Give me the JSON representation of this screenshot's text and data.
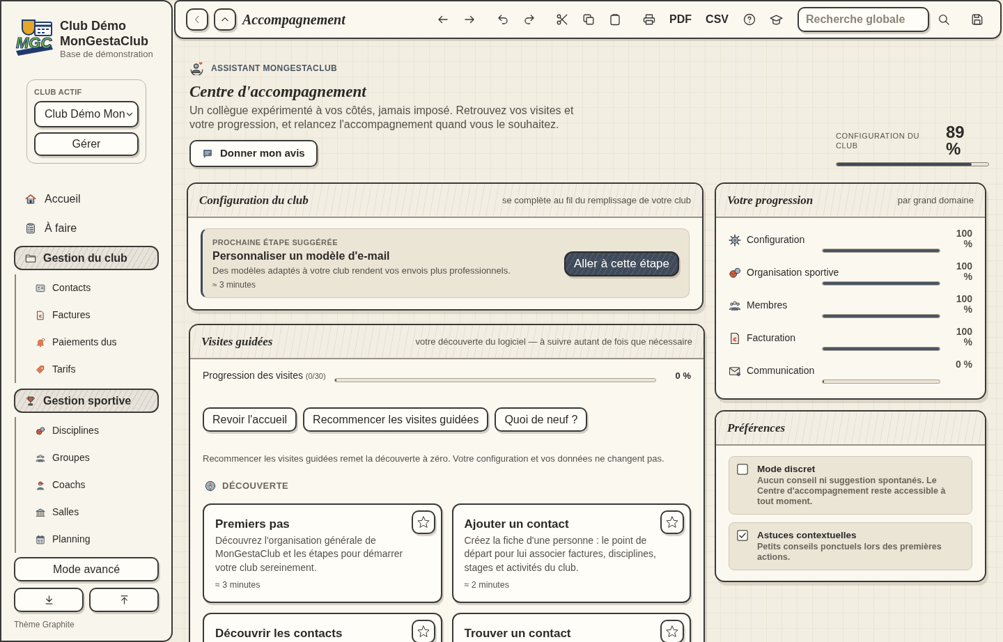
{
  "sidebar": {
    "logo_text": "MGC",
    "club_name": "Club Démo MonGestaClub",
    "subtitle": "Base de démonstration",
    "active_club": {
      "label": "CLUB ACTIF",
      "value": "Club Démo Mon",
      "manage_button": "Gérer"
    },
    "nav": [
      {
        "kind": "link",
        "label": "Accueil"
      },
      {
        "kind": "link",
        "label": "À faire"
      },
      {
        "kind": "group",
        "label": "Gestion du club",
        "expanded": true,
        "children": [
          {
            "label": "Contacts"
          },
          {
            "label": "Factures"
          },
          {
            "label": "Paiements dus"
          },
          {
            "label": "Tarifs"
          }
        ]
      },
      {
        "kind": "group",
        "label": "Gestion sportive",
        "expanded": true,
        "children": [
          {
            "label": "Disciplines"
          },
          {
            "label": "Groupes"
          },
          {
            "label": "Coachs"
          },
          {
            "label": "Salles"
          },
          {
            "label": "Planning"
          }
        ]
      }
    ],
    "advanced_button": "Mode avancé",
    "theme_label": "Thème Graphite"
  },
  "toolbar": {
    "title": "Accompagnement",
    "export_buttons": [
      "PDF",
      "CSV"
    ],
    "search": {
      "placeholder": "Recherche globale"
    }
  },
  "assistant": {
    "eyebrow": "ASSISTANT MONGESTACLUB",
    "title": "Centre d'accompagnement",
    "description": "Un collègue expérimenté à vos côtés, jamais imposé. Retrouvez vos visites et votre progression, et relancez l'accompagnement quand vous le souhaitez.",
    "feedback_button": "Donner mon avis",
    "club_config": {
      "label": "CONFIGURATION DU CLUB",
      "reading": "89 %",
      "level": 0.89
    }
  },
  "configuration_card": {
    "title": "Configuration du club",
    "subtitle": "se complète au fil du remplissage de votre club",
    "next_step": {
      "eyebrow": "PROCHAINE ÉTAPE SUGGÉRÉE",
      "title": "Personnaliser un modèle d'e-mail",
      "description": "Des modèles adaptés à votre club rendent vos envois plus professionnels.",
      "duration": "≈ 3 minutes",
      "button": "Aller à cette étape"
    }
  },
  "guided_tours": {
    "title": "Visites guidées",
    "subtitle": "votre découverte du logiciel — à suivre autant de fois que nécessaire",
    "progress": {
      "label": "Progression des visites",
      "count": "(0/30)",
      "level": 0,
      "reading": "0 %"
    },
    "buttons": [
      "Revoir l'accueil",
      "Recommencer les visites guidées",
      "Quoi de neuf ?"
    ],
    "note": "Recommencer les visites guidées remet la découverte à zéro. Votre configuration et vos données ne changent pas.",
    "section": "DÉCOUVERTE",
    "tours": [
      {
        "title": "Premiers pas",
        "description": "Découvrez l'organisation générale de MonGestaClub et les étapes pour démarrer votre club sereinement.",
        "duration": "≈ 3 minutes",
        "favorite": false
      },
      {
        "title": "Ajouter un contact",
        "description": "Créez la fiche d'une personne : le point de départ pour lui associer factures, disciplines, stages et activités du club.",
        "duration": "≈ 2 minutes",
        "favorite": false
      },
      {
        "title": "Découvrir les contacts",
        "favorite": false
      },
      {
        "title": "Trouver un contact",
        "favorite": false
      }
    ]
  },
  "progression": {
    "title": "Votre progression",
    "subtitle": "par grand domaine",
    "domains": [
      {
        "name": "Configuration",
        "level": 1,
        "reading": "100 %"
      },
      {
        "name": "Organisation sportive",
        "level": 1,
        "reading": "100 %"
      },
      {
        "name": "Membres",
        "level": 1,
        "reading": "100 %"
      },
      {
        "name": "Facturation",
        "level": 1,
        "reading": "100 %"
      },
      {
        "name": "Communication",
        "level": 0,
        "reading": "0 %"
      }
    ]
  },
  "preferences": {
    "title": "Préférences",
    "options": [
      {
        "title": "Mode discret",
        "description": "Aucun conseil ni suggestion spontanés. Le Centre d'accompagnement reste accessible à tout moment.",
        "checked": false
      },
      {
        "title": "Astuces contextuelles",
        "description": "Petits conseils ponctuels lors des premières actions.",
        "checked": true
      }
    ]
  }
}
